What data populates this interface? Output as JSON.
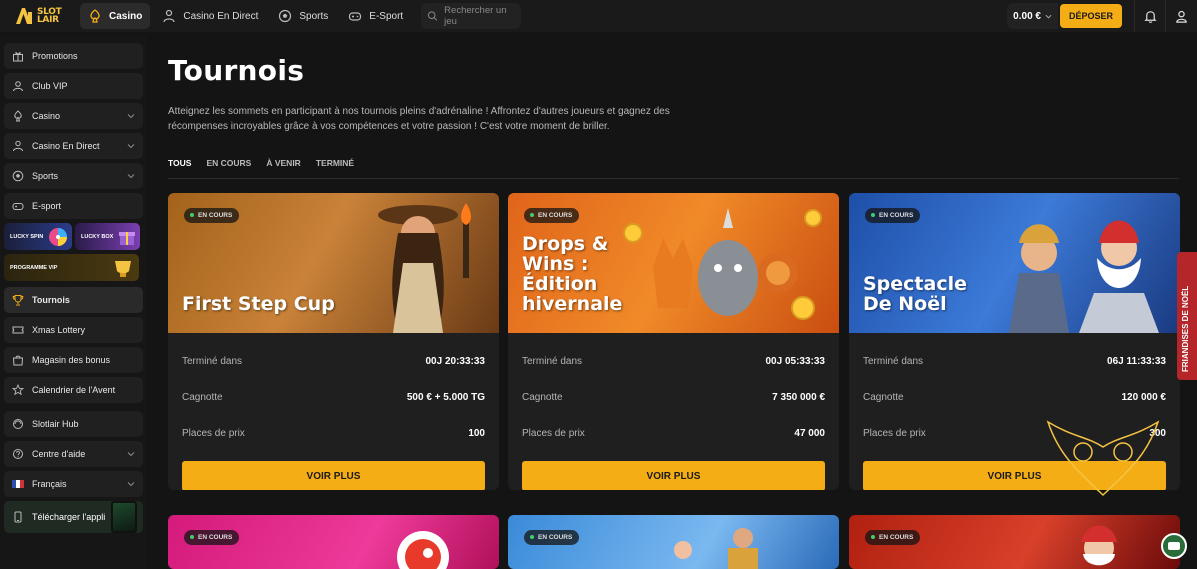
{
  "logo": {
    "line1": "SLOT",
    "line2": "LAIR"
  },
  "topnav": [
    {
      "label": "Casino",
      "icon": "casino-icon"
    },
    {
      "label": "Casino En Direct",
      "icon": "live-dealer-icon"
    },
    {
      "label": "Sports",
      "icon": "soccer-ball-icon"
    },
    {
      "label": "E-Sport",
      "icon": "gamepad-icon"
    }
  ],
  "search": {
    "placeholder": "Rechercher un jeu"
  },
  "account": {
    "balance": "0.00 €",
    "deposit_label": "DÉPOSER"
  },
  "sidebar": {
    "items_top": [
      {
        "label": "Promotions",
        "icon": "gift-icon"
      },
      {
        "label": "Club VIP",
        "icon": "user-icon"
      },
      {
        "label": "Casino",
        "icon": "casino-icon",
        "chevron": true
      },
      {
        "label": "Casino En Direct",
        "icon": "live-dealer-icon",
        "chevron": true
      },
      {
        "label": "Sports",
        "icon": "soccer-ball-icon",
        "chevron": true
      },
      {
        "label": "E-sport",
        "icon": "gamepad-icon"
      }
    ],
    "banners": {
      "spin": "LUCKY SPIN",
      "box": "LUCKY BOX",
      "vip": "PROGRAMME VIP"
    },
    "items_bottom": [
      {
        "label": "Tournois",
        "icon": "trophy-icon",
        "active": true
      },
      {
        "label": "Xmas Lottery",
        "icon": "ticket-icon"
      },
      {
        "label": "Magasin des bonus",
        "icon": "shop-icon"
      },
      {
        "label": "Calendrier de l'Avent",
        "icon": "star-icon"
      }
    ],
    "items_support": [
      {
        "label": "Slotlair Hub",
        "icon": "hub-icon"
      },
      {
        "label": "Centre d'aide",
        "icon": "help-icon",
        "chevron": true
      },
      {
        "label": "Français",
        "icon": "france-flag-icon",
        "chevron": true
      }
    ],
    "app_label": "Télécharger l'appli"
  },
  "page": {
    "title": "Tournois",
    "description": "Atteignez les sommets en participant à nos tournois pleins d'adrénaline ! Affrontez d'autres joueurs et gagnez des récompenses incroyables grâce à vos compétences et votre passion ! C'est votre moment de briller.",
    "tabs": [
      "TOUS",
      "EN COURS",
      "À VENIR",
      "TERMINÉ"
    ]
  },
  "labels": {
    "ends_in": "Terminé dans",
    "jackpot": "Cagnotte",
    "prizes": "Places de prix",
    "cta": "VOIR PLUS",
    "status": "EN COURS"
  },
  "cards": [
    {
      "title": "First Step Cup",
      "ends": "00J 20:33:33",
      "jackpot": "500 € + 5.000 TG",
      "prizes": "100"
    },
    {
      "title": "Drops & Wins : Édition hivernale",
      "ends": "00J 05:33:33",
      "jackpot": "7 350 000 €",
      "prizes": "47 000"
    },
    {
      "title": "Spectacle De Noël",
      "ends": "06J 11:33:33",
      "jackpot": "120 000 €",
      "prizes": "300"
    }
  ],
  "side_tab": "FRIANDISES DE NOËL",
  "colors": {
    "accent": "#f5ad16",
    "live": "#3ecf6a",
    "bg": "#141414",
    "card": "#1f1f1f"
  }
}
